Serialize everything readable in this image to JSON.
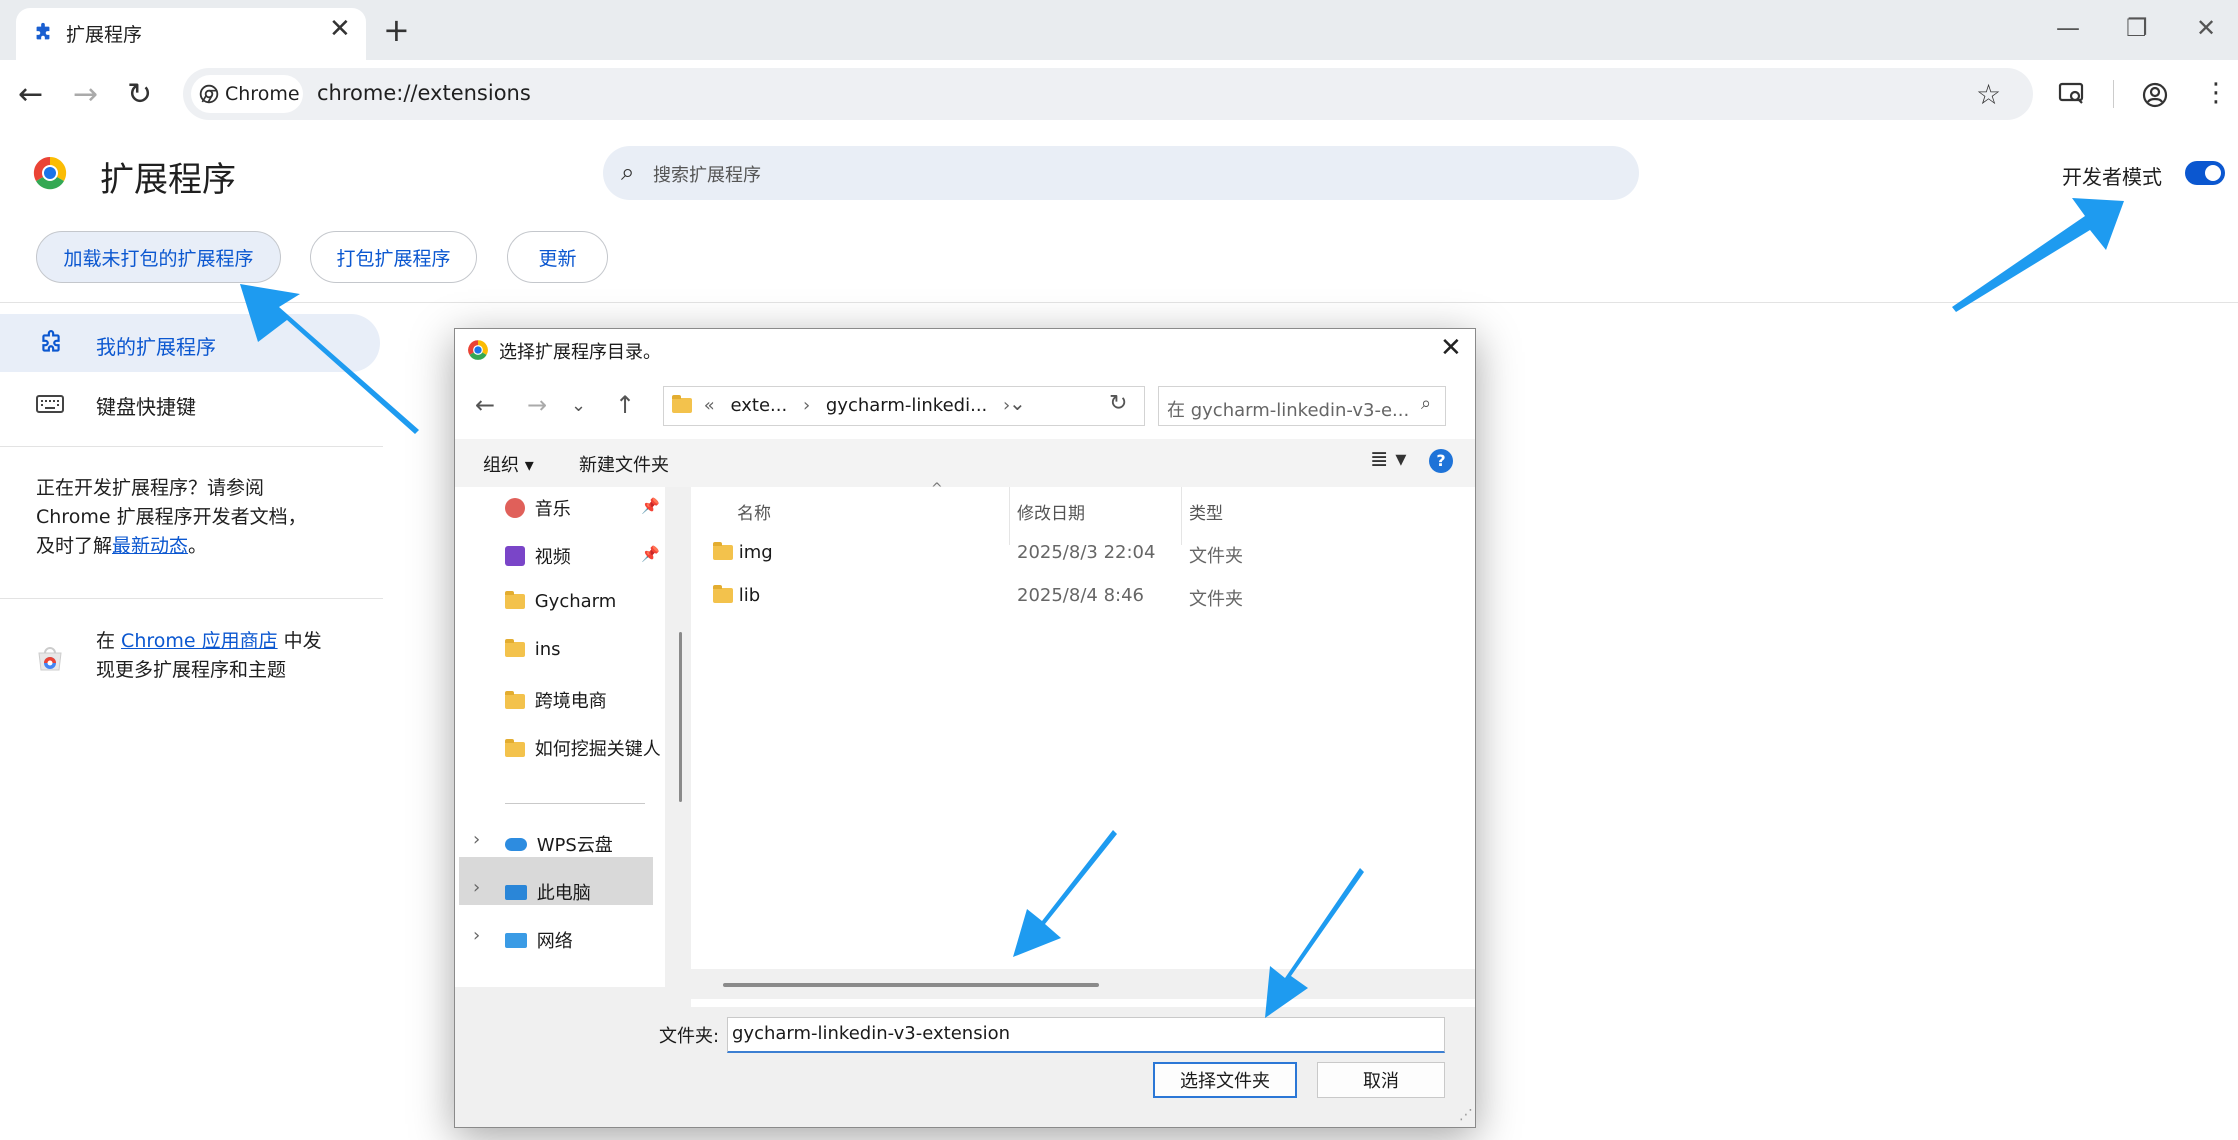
{
  "tab": {
    "title": "扩展程序",
    "close": "✕",
    "new": "+"
  },
  "window": {
    "minimize": "—",
    "restore": "❐",
    "close": "✕"
  },
  "toolbar": {
    "chip_label": "Chrome",
    "url": "chrome://extensions"
  },
  "page": {
    "title": "扩展程序",
    "search_placeholder": "搜索扩展程序",
    "dev_mode_label": "开发者模式",
    "dev_mode_on": true,
    "buttons": {
      "load_unpacked": "加载未打包的扩展程序",
      "pack": "打包扩展程序",
      "update": "更新"
    }
  },
  "sidebar": {
    "items": [
      {
        "label": "我的扩展程序",
        "active": true
      },
      {
        "label": "键盘快捷键",
        "active": false
      }
    ],
    "dev_note": {
      "line1": "正在开发扩展程序？请参阅",
      "line2": "Chrome 扩展程序开发者文档，",
      "line3_prefix": "及时了解",
      "line3_link": "最新动态",
      "line3_suffix": "。"
    },
    "store_note": {
      "prefix": "在 ",
      "link": "Chrome 应用商店",
      "suffix": " 中发",
      "line2": "现更多扩展程序和主题"
    }
  },
  "dialog": {
    "title": "选择扩展程序目录。",
    "address": {
      "prefix": "«",
      "seg1": "exte...",
      "seg2": "gycharm-linkedi...",
      "sep": "›"
    },
    "search_placeholder": "在 gycharm-linkedin-v3-e...",
    "commands": {
      "organize": "组织 ▾",
      "new_folder": "新建文件夹"
    },
    "tree": {
      "pinned": [
        {
          "label": "音乐",
          "icon": "music-icon"
        },
        {
          "label": "视频",
          "icon": "video-icon"
        },
        {
          "label": "Gycharm",
          "icon": "folder-icon"
        },
        {
          "label": "ins",
          "icon": "folder-icon"
        },
        {
          "label": "跨境电商",
          "icon": "folder-icon"
        },
        {
          "label": "如何挖掘关键人",
          "icon": "folder-icon"
        }
      ],
      "roots": [
        {
          "label": "WPS云盘",
          "icon": "cloud-icon"
        },
        {
          "label": "此电脑",
          "icon": "computer-icon",
          "selected": true
        },
        {
          "label": "网络",
          "icon": "network-icon"
        }
      ]
    },
    "columns": {
      "name": "名称",
      "date": "修改日期",
      "type": "类型"
    },
    "files": [
      {
        "name": "img",
        "date": "2025/8/3 22:04",
        "type": "文件夹"
      },
      {
        "name": "lib",
        "date": "2025/8/4 8:46",
        "type": "文件夹"
      }
    ],
    "filename_label": "文件夹:",
    "filename_value": "gycharm-linkedin-v3-extension",
    "select_button": "选择文件夹",
    "cancel_button": "取消"
  },
  "colors": {
    "accent": "#0b57d0",
    "arrow": "#1e9bf0"
  }
}
